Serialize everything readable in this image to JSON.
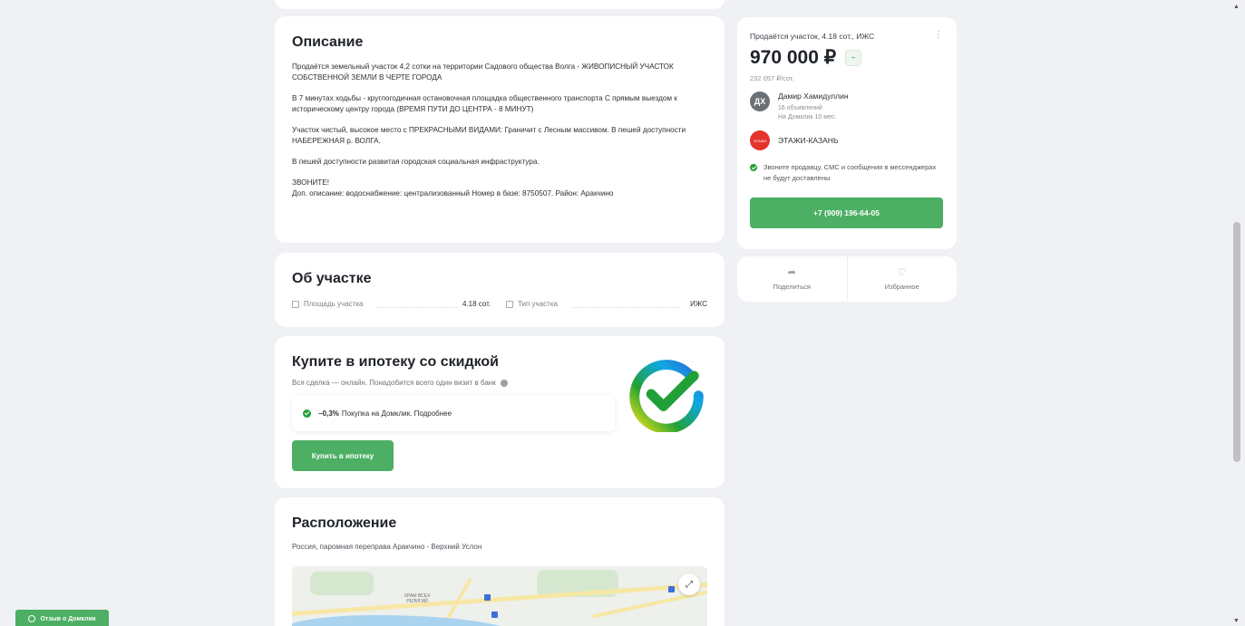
{
  "description": {
    "title": "Описание",
    "paragraphs": [
      "Продаётся земельный участок 4,2 сотки на территории Садового общества Волга - ЖИВОПИСНЫЙ УЧАСТОК СОБСТВЕННОЙ ЗЕМЛИ В ЧЕРТЕ ГОРОДА",
      "В 7 минутах ходьбы - круглогодичная остановочная площадка общественного транспорта С прямым выездом к историческому центру города (ВРЕМЯ ПУТИ ДО ЦЕНТРА - 8 МИНУТ)",
      "Участок чистый, высокое место с ПРЕКРАСНЫМИ ВИДАМИ: Граничит с Лесным массивом. В пешей доступности НАБЕРЕЖНАЯ р. ВОЛГА.",
      "В пешей доступности развитая городская социальная инфраструктура.",
      "ЗВОНИТЕ!",
      "Доп. описание: водоснабжение: централизованный Номер в базе: 8750507. Район: Аракчино"
    ]
  },
  "about": {
    "title": "Об участке",
    "area_label": "Площадь участка",
    "area_value": "4.18 сот.",
    "type_label": "Тип участка",
    "type_value": "ИЖС"
  },
  "mortgage": {
    "title": "Купите в ипотеку со скидкой",
    "subtitle": "Вся сделка — онлайн. Понадобится всего один визит в банк",
    "discount_value": "−0,3%",
    "discount_text": "Покупка на Домклик. Подробнее",
    "button_label": "Купить в ипотеку"
  },
  "location": {
    "title": "Расположение",
    "address": "Россия, паромная переправа Аракчино - Верхний Услон",
    "map_label": "ХРАМ ВСЕХ РЕЛИГИЙ"
  },
  "offer": {
    "title": "Продаётся участок, 4.18 сот., ИЖС",
    "menu_icon": "more-vertical-icon",
    "price": "970 000 ₽",
    "trend_icon": "price-trend-icon",
    "price_per_unit": "232 057 ₽/сот.",
    "agent_initials": "ДХ",
    "agent_name": "Дамир Хамидуллин",
    "agent_listings": "16 объявлений",
    "agent_tenure": "На Домклик 10 мес.",
    "agency_logo_text": "ЭТАЖИ",
    "agency_name": "ЭТАЖИ-КАЗАНЬ",
    "notice": "Звоните продавцу, СМС и сообщения в мессенджерах не будут доставлены",
    "phone": "+7 (909) 196-64-05"
  },
  "actions": {
    "share_label": "Поделиться",
    "favorite_label": "Избранное"
  },
  "feedback": {
    "label": "Отзыв о Домклик"
  },
  "colors": {
    "accent_green": "#4caf63",
    "sber_green": "#21a038",
    "background": "#f0f1f4",
    "agency_red": "#e5322d"
  }
}
